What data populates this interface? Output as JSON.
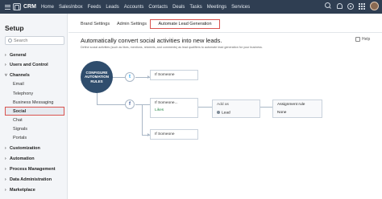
{
  "top_nav": {
    "app_name": "CRM",
    "items": [
      "Home",
      "SalesInbox",
      "Feeds",
      "Leads",
      "Accounts",
      "Contacts",
      "Deals",
      "Tasks",
      "Meetings",
      "Services"
    ]
  },
  "sidebar": {
    "title": "Setup",
    "search_placeholder": "Search",
    "general": "General",
    "users_control": "Users and Control",
    "channels": "Channels",
    "channel_items": [
      "Email",
      "Telephony",
      "Business Messaging",
      "Social",
      "Chat",
      "Signals",
      "Portals"
    ],
    "customization": "Customization",
    "automation": "Automation",
    "process": "Process Management",
    "data_admin": "Data Administration",
    "marketplace": "Marketplace"
  },
  "tabs": {
    "brand": "Brand Settings",
    "admin": "Admin Settings",
    "automate": "Automate Lead Generation"
  },
  "content": {
    "title": "Automatically convert social activities into new leads.",
    "description": "Define social activities (such as likes, mentions, retweets, and comments) as lead qualifiers to automate lead generation for your business.",
    "help": "Help"
  },
  "flow": {
    "main_label": "CONFIGURE AUTOMATION RULES",
    "twitter_glyph": "t",
    "facebook_glyph": "f",
    "if_someone": "If Someone",
    "if_someone_ellipsis": "If Someone...",
    "likes": "Likes",
    "add_as": "Add as",
    "lead": "Lead",
    "assignment_rule": "Assignment rule",
    "none": "None"
  }
}
